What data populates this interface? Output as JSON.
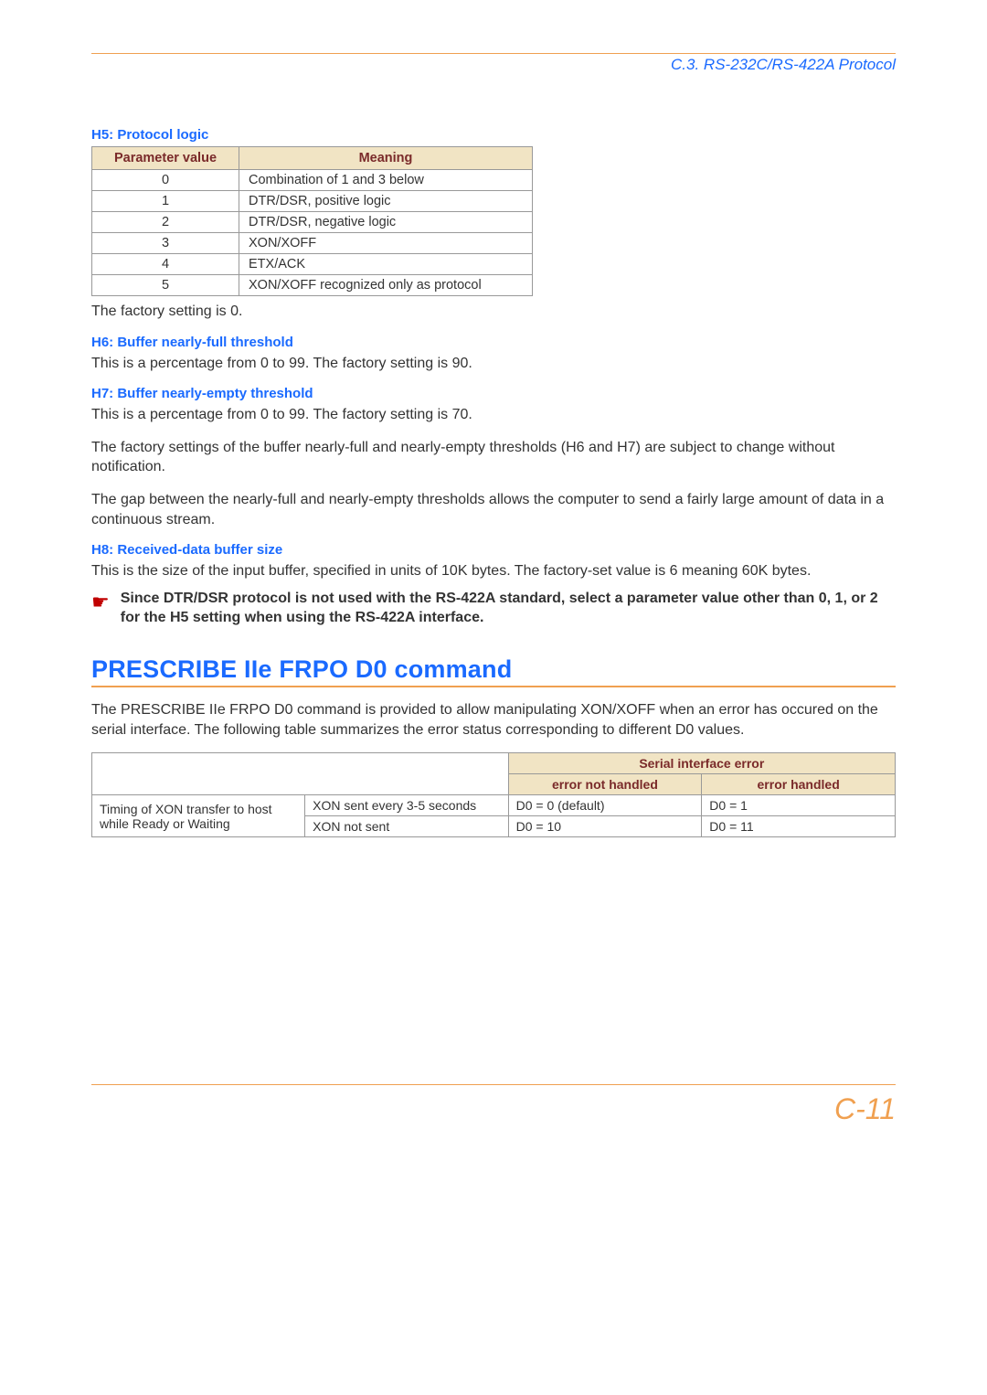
{
  "header": {
    "right_text": "C.3. RS-232C/RS-422A Protocol"
  },
  "h5": {
    "title": "H5: Protocol logic",
    "col1": "Parameter value",
    "col2": "Meaning",
    "rows": [
      {
        "pv": "0",
        "mn": "Combination of 1 and 3 below"
      },
      {
        "pv": "1",
        "mn": "DTR/DSR, positive logic"
      },
      {
        "pv": "2",
        "mn": "DTR/DSR, negative logic"
      },
      {
        "pv": "3",
        "mn": "XON/XOFF"
      },
      {
        "pv": "4",
        "mn": "ETX/ACK"
      },
      {
        "pv": "5",
        "mn": "XON/XOFF recognized only as protocol"
      }
    ],
    "after": "The factory setting is 0."
  },
  "h6": {
    "title": "H6: Buffer nearly-full threshold",
    "p": "This is a percentage from 0 to 99. The factory setting is 90."
  },
  "h7": {
    "title": "H7: Buffer nearly-empty threshold",
    "p1": "This is a percentage from 0 to 99. The factory setting is 70.",
    "p2": "The factory settings of the buffer nearly-full and nearly-empty thresholds (H6 and H7) are subject to change without notification.",
    "p3": "The gap between the nearly-full and nearly-empty thresholds allows the computer to send a fairly large amount of data in a continuous stream."
  },
  "h8": {
    "title": "H8: Received-data buffer size",
    "p": "This is the size of the input buffer, specified in units of 10K bytes. The factory-set value is 6 meaning 60K bytes."
  },
  "note": {
    "icon": "☛",
    "text": "Since DTR/DSR protocol is not used with the RS-422A standard, select a parameter value other than 0, 1, or 2 for the H5 setting when using the RS-422A interface."
  },
  "section": {
    "title": "PRESCRIBE IIe FRPO D0 command",
    "p": "The PRESCRIBE IIe FRPO D0 command is provided to allow manipulating XON/XOFF when an error has occured on the serial interface. The following table summarizes the error status corresponding to different D0 values."
  },
  "tbl2": {
    "h_serial": "Serial interface error",
    "h_not": "error not handled",
    "h_yes": "error handled",
    "row_label": "Timing of XON transfer to host while Ready or Waiting",
    "r1c": "XON sent every 3-5 seconds",
    "r1n": "D0 = 0 (default)",
    "r1y": "D0 = 1",
    "r2c": "XON not sent",
    "r2n": "D0 = 10",
    "r2y": "D0 = 11"
  },
  "page_number": "C-11"
}
